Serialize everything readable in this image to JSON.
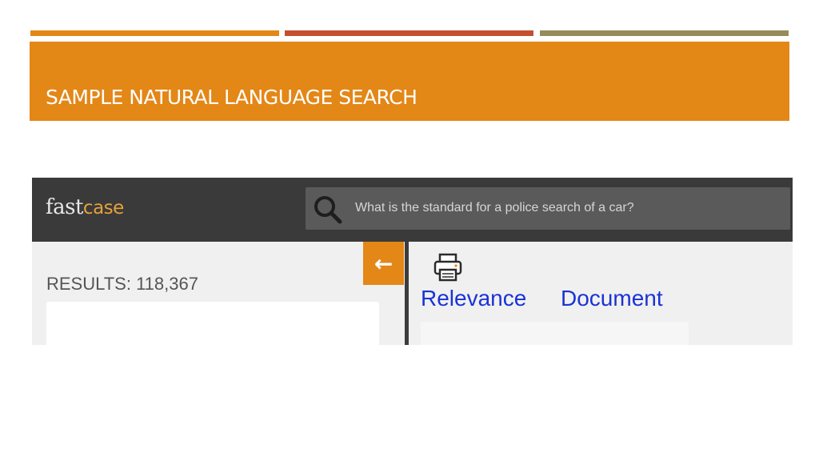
{
  "slide": {
    "title": "SAMPLE NATURAL LANGUAGE SEARCH",
    "colors": {
      "title_band": "#e38717",
      "accent_1": "#e38717",
      "accent_2": "#c3502b",
      "accent_3": "#968b5a",
      "title_text": "#ffffff"
    }
  },
  "app": {
    "logo": {
      "part1": "fast",
      "part2": "case",
      "color_part2": "#e5a23a"
    },
    "search": {
      "icon": "search-icon",
      "query": "What is the standard for a police search of a car?"
    },
    "left_panel": {
      "results_label": "RESULTS: 118,367",
      "collapse_icon": "arrow-left-icon",
      "collapse_symbol": "←",
      "collapse_color": "#e38717"
    },
    "right_panel": {
      "print_icon": "printer-icon",
      "sort_options": [
        "Relevance",
        "Document"
      ],
      "link_color": "#1a33d6"
    }
  }
}
